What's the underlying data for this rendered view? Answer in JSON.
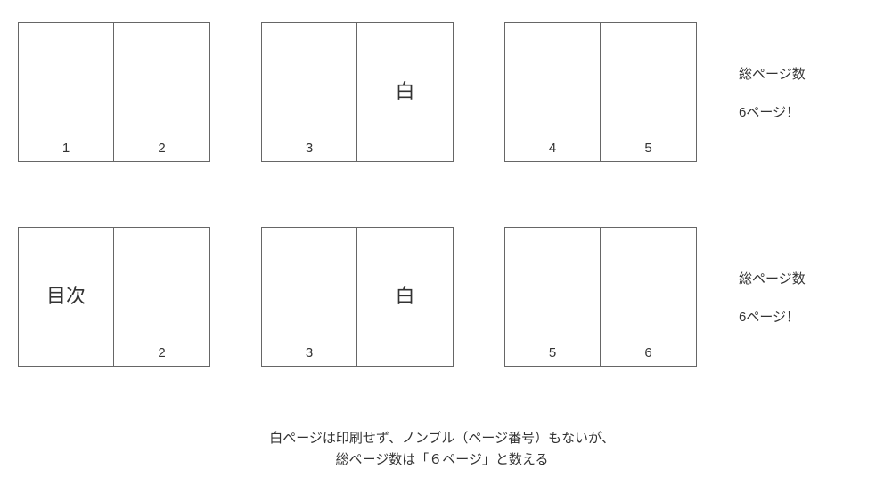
{
  "rows": [
    {
      "spreads": [
        {
          "left": {
            "center": "",
            "num": "1"
          },
          "right": {
            "center": "",
            "num": "2"
          }
        },
        {
          "left": {
            "center": "",
            "num": "3"
          },
          "right": {
            "center": "白",
            "num": ""
          }
        },
        {
          "left": {
            "center": "",
            "num": "4"
          },
          "right": {
            "center": "",
            "num": "5"
          }
        }
      ],
      "side": {
        "line1": "総ページ数",
        "line2": "6ページ！"
      }
    },
    {
      "spreads": [
        {
          "left": {
            "center": "目次",
            "num": ""
          },
          "right": {
            "center": "",
            "num": "2"
          }
        },
        {
          "left": {
            "center": "",
            "num": "3"
          },
          "right": {
            "center": "白",
            "num": ""
          }
        },
        {
          "left": {
            "center": "",
            "num": "5"
          },
          "right": {
            "center": "",
            "num": "6"
          }
        }
      ],
      "side": {
        "line1": "総ページ数",
        "line2": "6ページ！"
      }
    }
  ],
  "caption": {
    "line1": "白ページは印刷せず、ノンブル（ページ番号）もないが、",
    "line2": "総ページ数は「６ページ」と数える"
  }
}
